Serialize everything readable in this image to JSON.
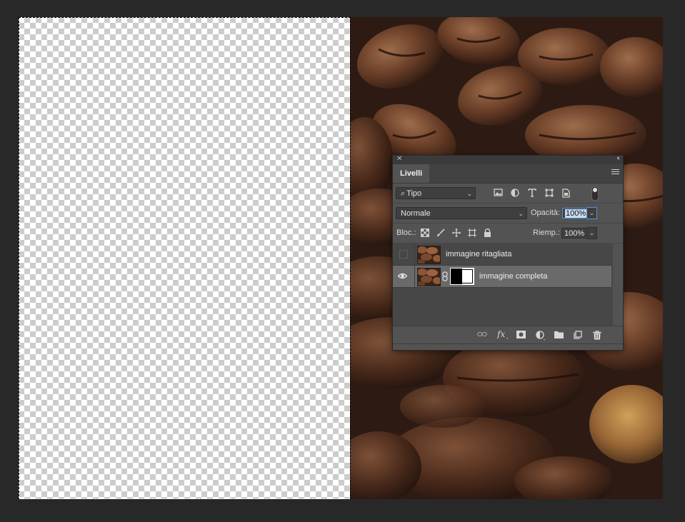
{
  "panel": {
    "tab_label": "Livelli",
    "filter": {
      "selected": "Tipo",
      "search_glyph": "⌕"
    },
    "blend_mode": "Normale",
    "opacity_label": "Opacità:",
    "opacity_value": "100%",
    "lock_label": "Bloc.:",
    "fill_label": "Riemp.:",
    "fill_value": "100%"
  },
  "layers": [
    {
      "name": "immagine ritagliata",
      "visible": false,
      "selected": false,
      "has_mask": false
    },
    {
      "name": "immagine completa",
      "visible": true,
      "selected": true,
      "has_mask": true
    }
  ],
  "icons": {
    "filter_icons": [
      "image-filter-icon",
      "adjustment-filter-icon",
      "type-filter-icon",
      "shape-filter-icon",
      "smart-object-filter-icon"
    ],
    "lock_icons": [
      "lock-transparent-pixels-icon",
      "lock-image-pixels-icon",
      "lock-position-icon",
      "lock-artboard-icon",
      "lock-all-icon"
    ],
    "footer_icons": [
      "link-layers-icon",
      "fx-icon",
      "add-mask-icon",
      "new-adjustment-icon",
      "new-group-icon",
      "new-layer-icon",
      "delete-layer-icon"
    ]
  },
  "colors": {
    "workspace": "#282828",
    "panel": "#535353",
    "selection": "#4f8fd6"
  }
}
